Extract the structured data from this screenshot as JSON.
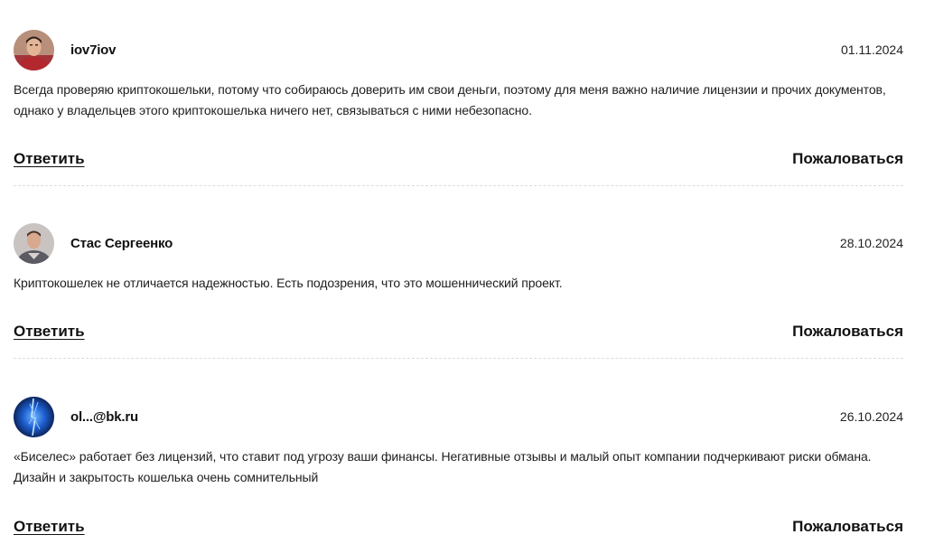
{
  "comments": [
    {
      "author": "iov7iov",
      "date": "01.11.2024",
      "text": "Всегда проверяю криптокошельки, потому что собираюсь доверить им свои деньги, поэтому для меня важно наличие лицензии и прочих документов, однако у владельцев этого криптокошелька ничего нет, связываться с ними небезопасно.",
      "reply_label": "Ответить",
      "report_label": "Пожаловаться",
      "avatar_icon": "user-photo-avatar"
    },
    {
      "author": "Стас Сергеенко",
      "date": "28.10.2024",
      "text": "Криптокошелек не отличается надежностью. Есть подозрения, что это мошеннический проект.",
      "reply_label": "Ответить",
      "report_label": "Пожаловаться",
      "avatar_icon": "user-photo-avatar"
    },
    {
      "author": "ol...@bk.ru",
      "date": "26.10.2024",
      "text": "«Биселес» работает без лицензий, что ставит под угрозу ваши финансы. Негативные отзывы и малый опыт компании подчеркивают риски обмана. Дизайн и закрытость кошелька очень сомнительный",
      "reply_label": "Ответить",
      "report_label": "Пожаловаться",
      "avatar_icon": "abstract-blue-avatar"
    }
  ],
  "colors": {
    "text": "#1e1e1e",
    "divider": "#dcdcdc",
    "background": "#ffffff"
  }
}
